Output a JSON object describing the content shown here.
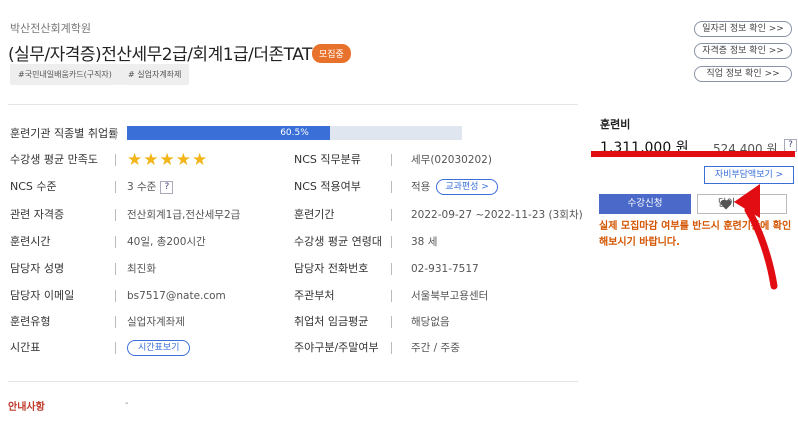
{
  "course": {
    "provider": "박산전산회계학원",
    "title": "(실무/자격증)전산세무2급/회계1급/더존TAT",
    "status_badge": "모집중",
    "tags": [
      "#국민내일배움카드(구직자)",
      "# 실업자계좌제"
    ]
  },
  "links": [
    "일자리 정보 확인 >>",
    "자격증 정보 확인 >>",
    "직업 정보 확인 >>"
  ],
  "info": {
    "employment_rate_label": "훈련기관 직종별 취업률",
    "employment_rate_text": "60.5%",
    "employment_rate_value": 60.5,
    "satisfaction_label": "수강생 평균 만족도",
    "satisfaction_stars": "★★★★★",
    "ncs_class_label": "NCS 직무분류",
    "ncs_class_value": "세무(02030202)",
    "ncs_level_label": "NCS 수준",
    "ncs_level_value": "3 수준",
    "ncs_apply_label": "NCS 적용여부",
    "ncs_apply_value": "적용",
    "curriculum_button": "교과편성 >",
    "cert_label": "관련 자격증",
    "cert_value": "전산회계1급,전산세무2급",
    "period_label": "훈련기간",
    "period_value": "2022-09-27 ~2022-11-23 (3회차)",
    "hours_label": "훈련시간",
    "hours_value": "40일, 총200시간",
    "age_label": "수강생 평균 연령대",
    "age_value": "38 세",
    "manager_label": "담당자 성명",
    "manager_value": "최진화",
    "phone_label": "담당자 전화번호",
    "phone_value": "02-931-7517",
    "email_label": "담당자 이메일",
    "email_value": "bs7517@nate.com",
    "ministry_label": "주관부처",
    "ministry_value": "서울북부고용센터",
    "type_label": "훈련유형",
    "type_value": "실업자계좌제",
    "wage_label": "취업처 임금평균",
    "wage_value": "해당없음",
    "schedule_label": "시간표",
    "schedule_button": "시간표보기",
    "daynight_label": "주야구분/주말여부",
    "daynight_value": "주간 / 주중",
    "q_mark": "?"
  },
  "notice": {
    "label": "안내사항",
    "value": "-"
  },
  "fee": {
    "label": "훈련비",
    "total": "1,311,000 원",
    "self_pay": "524,400 원",
    "self_pay_button": "자비부담액보기 >",
    "apply_button": "수강신청",
    "wish_button": "담아",
    "warning": "실제 모집마감 여부를 반드시 훈련기관에 확인해보시기 바랍니다."
  },
  "colors": {
    "accent": "#3a6fd8",
    "badge": "#e8712b",
    "warning": "#d35400",
    "annotation": "#e20d12"
  }
}
